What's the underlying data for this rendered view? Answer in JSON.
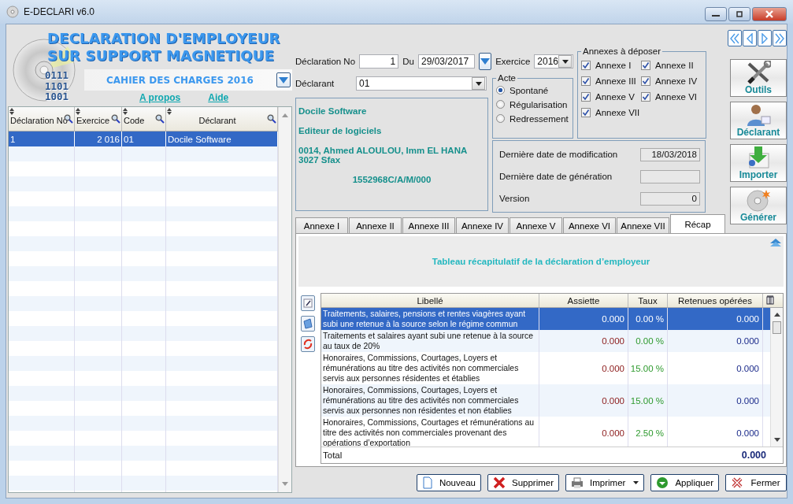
{
  "window": {
    "title": "E-DECLARI v6.0"
  },
  "header": {
    "title_lines": [
      "DECLARATION D'EMPLOYEUR",
      "SUR SUPPORT MAGNETIQUE"
    ],
    "logo_digits": [
      "0111",
      "1101",
      "1001"
    ],
    "subtitle": "CAHIER DES CHARGES 2016",
    "links": [
      "A propos",
      "Aide"
    ]
  },
  "declarations": {
    "columns": [
      "Déclaration No",
      "Exercice",
      "Code",
      "Déclarant"
    ],
    "rows": [
      {
        "cells": [
          "1",
          "2 016",
          "01",
          "Docile Software"
        ],
        "selected": true
      }
    ]
  },
  "form": {
    "number_label": "Déclaration No",
    "number": "1",
    "date_label": "Du",
    "date": "29/03/2017",
    "year_label": "Exercice",
    "year": "2016",
    "declarant_label": "Déclarant",
    "declarant": "01"
  },
  "declarant_info": {
    "name": "Docile Software",
    "activity": "Editeur de logiciels",
    "address": [
      "0014, Ahmed ALOULOU, Imm EL HANA",
      "3027 Sfax"
    ],
    "tax_id": "1552968C/A/M/000"
  },
  "acte": {
    "title": "Acte",
    "options": [
      {
        "label": "Spontané",
        "selected": true
      },
      {
        "label": "Régularisation",
        "selected": false
      },
      {
        "label": "Redressement",
        "selected": false
      }
    ]
  },
  "annexes": {
    "title": "Annexes à déposer",
    "items": [
      {
        "label": "Annexe I",
        "checked": true
      },
      {
        "label": "Annexe II",
        "checked": true
      },
      {
        "label": "Annexe III",
        "checked": true
      },
      {
        "label": "Annexe IV",
        "checked": true
      },
      {
        "label": "Annexe V",
        "checked": true
      },
      {
        "label": "Annexe VI",
        "checked": true
      },
      {
        "label": "Annexe VII",
        "checked": true
      }
    ]
  },
  "status": [
    {
      "label": "Dernière date de modification",
      "value": "18/03/2018"
    },
    {
      "label": "Dernière date de génération"
    },
    {
      "label": "Version",
      "value": "0"
    }
  ],
  "side_buttons": [
    {
      "label": "Outils",
      "kind": "tools"
    },
    {
      "label": "Déclarant",
      "kind": "person"
    },
    {
      "label": "Importer",
      "kind": "import"
    },
    {
      "label": "Générer",
      "kind": "disc"
    }
  ],
  "tabs": [
    {
      "label": "Annexe I",
      "selected": false
    },
    {
      "label": "Annexe II",
      "selected": false
    },
    {
      "label": "Annexe III",
      "selected": false
    },
    {
      "label": "Annexe IV",
      "selected": false
    },
    {
      "label": "Annexe V",
      "selected": false
    },
    {
      "label": "Annexe VI",
      "selected": false
    },
    {
      "label": "Annexe VII",
      "selected": false
    },
    {
      "label": "Récap",
      "selected": true
    }
  ],
  "recap": {
    "title": "Tableau récapitulatif de la déclaration d’employeur",
    "columns": [
      "Libellé",
      "Assiette",
      "Taux",
      "Retenues opérées"
    ],
    "rows": [
      {
        "libelle": [
          "Traitements, salaires, pensions et rentes viagères ayant",
          "subi une retenue à la source selon le régime commun"
        ],
        "assiette": "0.000",
        "taux": "0.00 %",
        "retenues": "0.000",
        "selected": true
      },
      {
        "libelle": [
          "Traitements et salaires ayant subi une retenue à la source",
          "au taux de 20%"
        ],
        "assiette": "0.000",
        "taux": "0.00 %",
        "retenues": "0.000",
        "selected": false
      },
      {
        "libelle": [
          "Honoraires, Commissions, Courtages, Loyers et",
          "rémunérations au titre des activités non commerciales",
          "servis aux personnes résidentes et établies"
        ],
        "assiette": "0.000",
        "taux": "15.00 %",
        "retenues": "0.000",
        "selected": false
      },
      {
        "libelle": [
          "Honoraires, Commissions, Courtages, Loyers et",
          "rémunérations au titre des activités non commerciales",
          "servis aux personnes non résidentes et non établies"
        ],
        "assiette": "0.000",
        "taux": "15.00 %",
        "retenues": "0.000",
        "selected": false
      },
      {
        "libelle": [
          "Honoraires, Commissions, Courtages et rémunérations au",
          "titre des activités non commerciales provenant des",
          "opérations d’exportation"
        ],
        "assiette": "0.000",
        "taux": "2.50 %",
        "retenues": "0.000",
        "selected": false
      }
    ],
    "total_label": "Total",
    "total": "0.000"
  },
  "buttons": [
    {
      "label": "Nouveau",
      "kind": "new"
    },
    {
      "label": "Supprimer",
      "kind": "delete"
    },
    {
      "label": "Imprimer",
      "kind": "print",
      "menu": true
    },
    {
      "label": "Appliquer",
      "kind": "apply"
    },
    {
      "label": "Fermer",
      "kind": "close"
    }
  ]
}
